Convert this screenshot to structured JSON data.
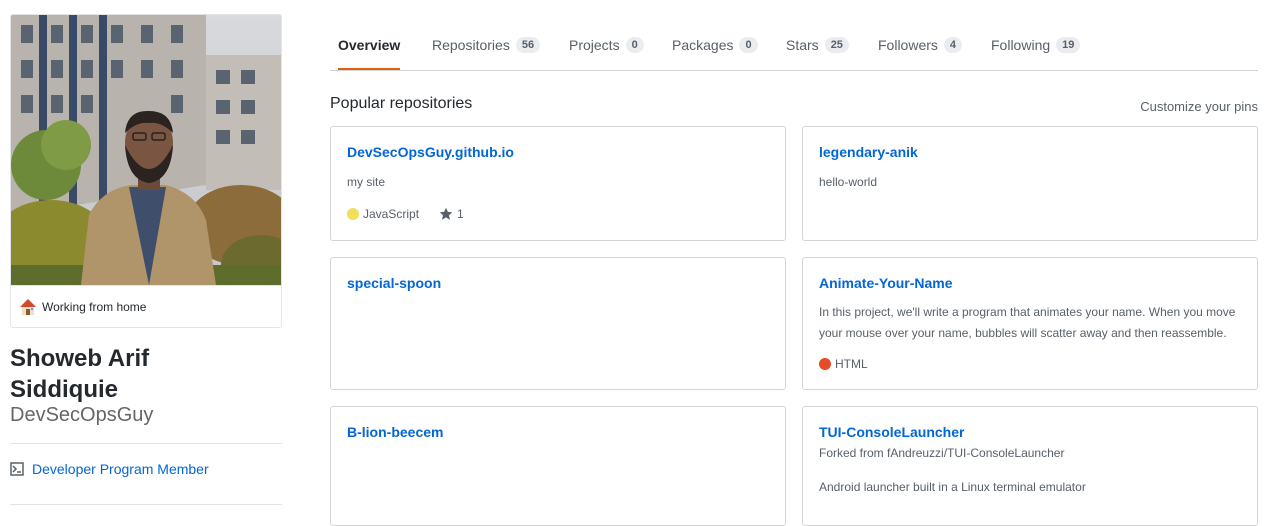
{
  "profile": {
    "status": "Working from home",
    "name_line1": "Showeb Arif",
    "name_line2": "Siddiquie",
    "login": "DevSecOpsGuy",
    "badge": "Developer Program Member"
  },
  "tabs": [
    {
      "label": "Overview"
    },
    {
      "label": "Repositories",
      "count": "56"
    },
    {
      "label": "Projects",
      "count": "0"
    },
    {
      "label": "Packages",
      "count": "0"
    },
    {
      "label": "Stars",
      "count": "25"
    },
    {
      "label": "Followers",
      "count": "4"
    },
    {
      "label": "Following",
      "count": "19"
    }
  ],
  "section": {
    "title": "Popular repositories",
    "customize": "Customize your pins"
  },
  "repos": [
    {
      "name": "DevSecOpsGuy.github.io",
      "desc": "my site",
      "language": "JavaScript",
      "lang_color": "#f1e05a",
      "stars": "1"
    },
    {
      "name": "legendary-anik",
      "desc": "hello-world"
    },
    {
      "name": "special-spoon"
    },
    {
      "name": "Animate-Your-Name",
      "desc": "In this project, we'll write a program that animates your name. When you move your mouse over your name, bubbles will scatter away and then reassemble.",
      "language": "HTML",
      "lang_color": "#e34c26"
    },
    {
      "name": "B-lion-beecem"
    },
    {
      "name": "TUI-ConsoleLauncher",
      "forked": "Forked from fAndreuzzi/TUI-ConsoleLauncher",
      "desc": "Android launcher built in a Linux terminal emulator"
    }
  ]
}
